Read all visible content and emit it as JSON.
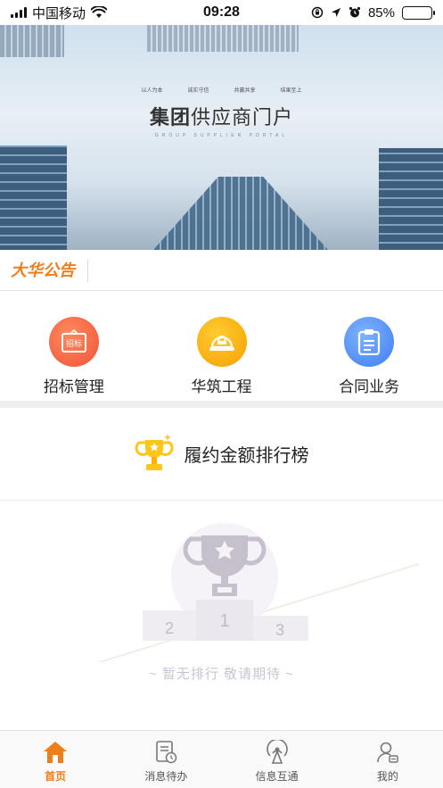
{
  "status_bar": {
    "carrier": "中国移动",
    "time": "09:28",
    "battery": "85%",
    "battery_level": 0.85,
    "icons": [
      "signal-icon",
      "wifi-icon",
      "rotation-lock-icon",
      "location-icon",
      "alarm-icon",
      "battery-icon"
    ]
  },
  "banner": {
    "title_bold": "集团",
    "title_rest": "供应商门户",
    "subtitle": "GROUP SUPPLIER PORTAL",
    "tags": [
      "以人为本",
      "诚实守信",
      "共赢共享",
      "结果至上"
    ]
  },
  "notice": {
    "logo_text": "大华公告"
  },
  "menu": {
    "items": [
      {
        "label": "招标管理",
        "icon": "bid-board-icon",
        "icon_text": "招标"
      },
      {
        "label": "华筑工程",
        "icon": "helmet-icon"
      },
      {
        "label": "合同业务",
        "icon": "clipboard-icon"
      }
    ]
  },
  "ranking": {
    "title": "履约金额排行榜",
    "empty_text": "~ 暂无排行 敬请期待 ~",
    "podium": [
      "2",
      "1",
      "3"
    ]
  },
  "tabbar": {
    "items": [
      {
        "label": "首页",
        "icon": "home-icon",
        "active": true
      },
      {
        "label": "消息待办",
        "icon": "todo-doc-icon",
        "active": false
      },
      {
        "label": "信息互通",
        "icon": "broadcast-icon",
        "active": false
      },
      {
        "label": "我的",
        "icon": "user-icon",
        "active": false
      }
    ]
  },
  "colors": {
    "accent": "#f07d1a",
    "menu_red": "#f0533a",
    "menu_orange": "#f5a000",
    "menu_blue": "#3f7cf0"
  }
}
